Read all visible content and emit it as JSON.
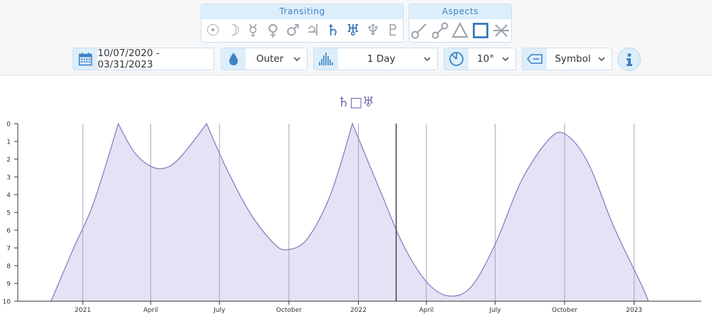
{
  "transiting": {
    "label": "Transiting",
    "bodies": [
      {
        "name": "sun-icon",
        "glyph": "☉",
        "active": false
      },
      {
        "name": "moon-icon",
        "glyph": "☽",
        "active": false
      },
      {
        "name": "mercury-icon",
        "glyph": "☿",
        "active": false
      },
      {
        "name": "venus-icon",
        "glyph": "♀",
        "active": false
      },
      {
        "name": "mars-icon",
        "glyph": "♂",
        "active": false
      },
      {
        "name": "jupiter-icon",
        "glyph": "♃",
        "active": false
      },
      {
        "name": "saturn-icon",
        "glyph": "♄",
        "active": true
      },
      {
        "name": "uranus-icon",
        "glyph": "♅",
        "active": true
      },
      {
        "name": "neptune-icon",
        "glyph": "♆",
        "active": false
      },
      {
        "name": "pluto-icon",
        "glyph": "♇",
        "active": false
      }
    ]
  },
  "aspects": {
    "label": "Aspects",
    "items": [
      {
        "name": "conjunction-icon",
        "active": false
      },
      {
        "name": "opposition-icon",
        "active": false
      },
      {
        "name": "trine-icon",
        "active": false
      },
      {
        "name": "square-icon",
        "active": true
      },
      {
        "name": "sextile-icon",
        "active": false
      }
    ]
  },
  "controls": {
    "date_range": "10/07/2020 - 03/31/2023",
    "planet_set": "Outer",
    "interval": "1 Day",
    "orb": "10°",
    "display": "Symbol"
  },
  "chart_title": "♄□♅",
  "colors": {
    "accent": "#3d82c4",
    "panel": "#ddeefb",
    "series_line": "#8e7cc3",
    "series_fill": "#e6e1f4"
  },
  "chart_data": {
    "type": "area",
    "title": "♄□♅",
    "series_name": "",
    "y_axis": {
      "ticks": [
        "0",
        "1",
        "2",
        "3",
        "4",
        "5",
        "6",
        "7",
        "8",
        "9",
        "10"
      ],
      "ylim": [
        0,
        10
      ],
      "inverted": true,
      "meaning": "orb (degrees)"
    },
    "x_axis": {
      "range": [
        "2020-10-07",
        "2023-03-31"
      ],
      "ticks": [
        {
          "date": "2021-01-01",
          "label": "2021"
        },
        {
          "date": "2021-04-01",
          "label": "April"
        },
        {
          "date": "2021-07-01",
          "label": "July"
        },
        {
          "date": "2021-10-01",
          "label": "October"
        },
        {
          "date": "2022-01-01",
          "label": "2022"
        },
        {
          "date": "2022-04-01",
          "label": "April"
        },
        {
          "date": "2022-07-01",
          "label": "July"
        },
        {
          "date": "2022-10-01",
          "label": "October"
        },
        {
          "date": "2023-01-01",
          "label": "2023"
        }
      ]
    },
    "current_date_marker": "2022-02-20",
    "points": [
      {
        "date": "2020-11-20",
        "orb": 10.0
      },
      {
        "date": "2020-12-20",
        "orb": 7.0
      },
      {
        "date": "2021-01-15",
        "orb": 4.5
      },
      {
        "date": "2021-02-17",
        "orb": 0.0
      },
      {
        "date": "2021-03-10",
        "orb": 1.6
      },
      {
        "date": "2021-04-01",
        "orb": 2.4
      },
      {
        "date": "2021-04-20",
        "orb": 2.5
      },
      {
        "date": "2021-05-10",
        "orb": 1.9
      },
      {
        "date": "2021-06-14",
        "orb": 0.0
      },
      {
        "date": "2021-07-10",
        "orb": 2.5
      },
      {
        "date": "2021-08-10",
        "orb": 5.0
      },
      {
        "date": "2021-09-10",
        "orb": 6.7
      },
      {
        "date": "2021-09-28",
        "orb": 7.1
      },
      {
        "date": "2021-10-25",
        "orb": 6.5
      },
      {
        "date": "2021-11-25",
        "orb": 4.0
      },
      {
        "date": "2021-12-24",
        "orb": 0.0
      },
      {
        "date": "2022-02-01",
        "orb": 4.0
      },
      {
        "date": "2022-03-01",
        "orb": 6.8
      },
      {
        "date": "2022-04-01",
        "orb": 8.9
      },
      {
        "date": "2022-04-30",
        "orb": 9.7
      },
      {
        "date": "2022-05-30",
        "orb": 9.2
      },
      {
        "date": "2022-07-01",
        "orb": 6.8
      },
      {
        "date": "2022-08-05",
        "orb": 3.2
      },
      {
        "date": "2022-09-10",
        "orb": 0.9
      },
      {
        "date": "2022-10-02",
        "orb": 0.6
      },
      {
        "date": "2022-11-01",
        "orb": 2.2
      },
      {
        "date": "2022-12-05",
        "orb": 5.8
      },
      {
        "date": "2023-01-10",
        "orb": 9.0
      },
      {
        "date": "2023-01-20",
        "orb": 10.0
      }
    ]
  }
}
